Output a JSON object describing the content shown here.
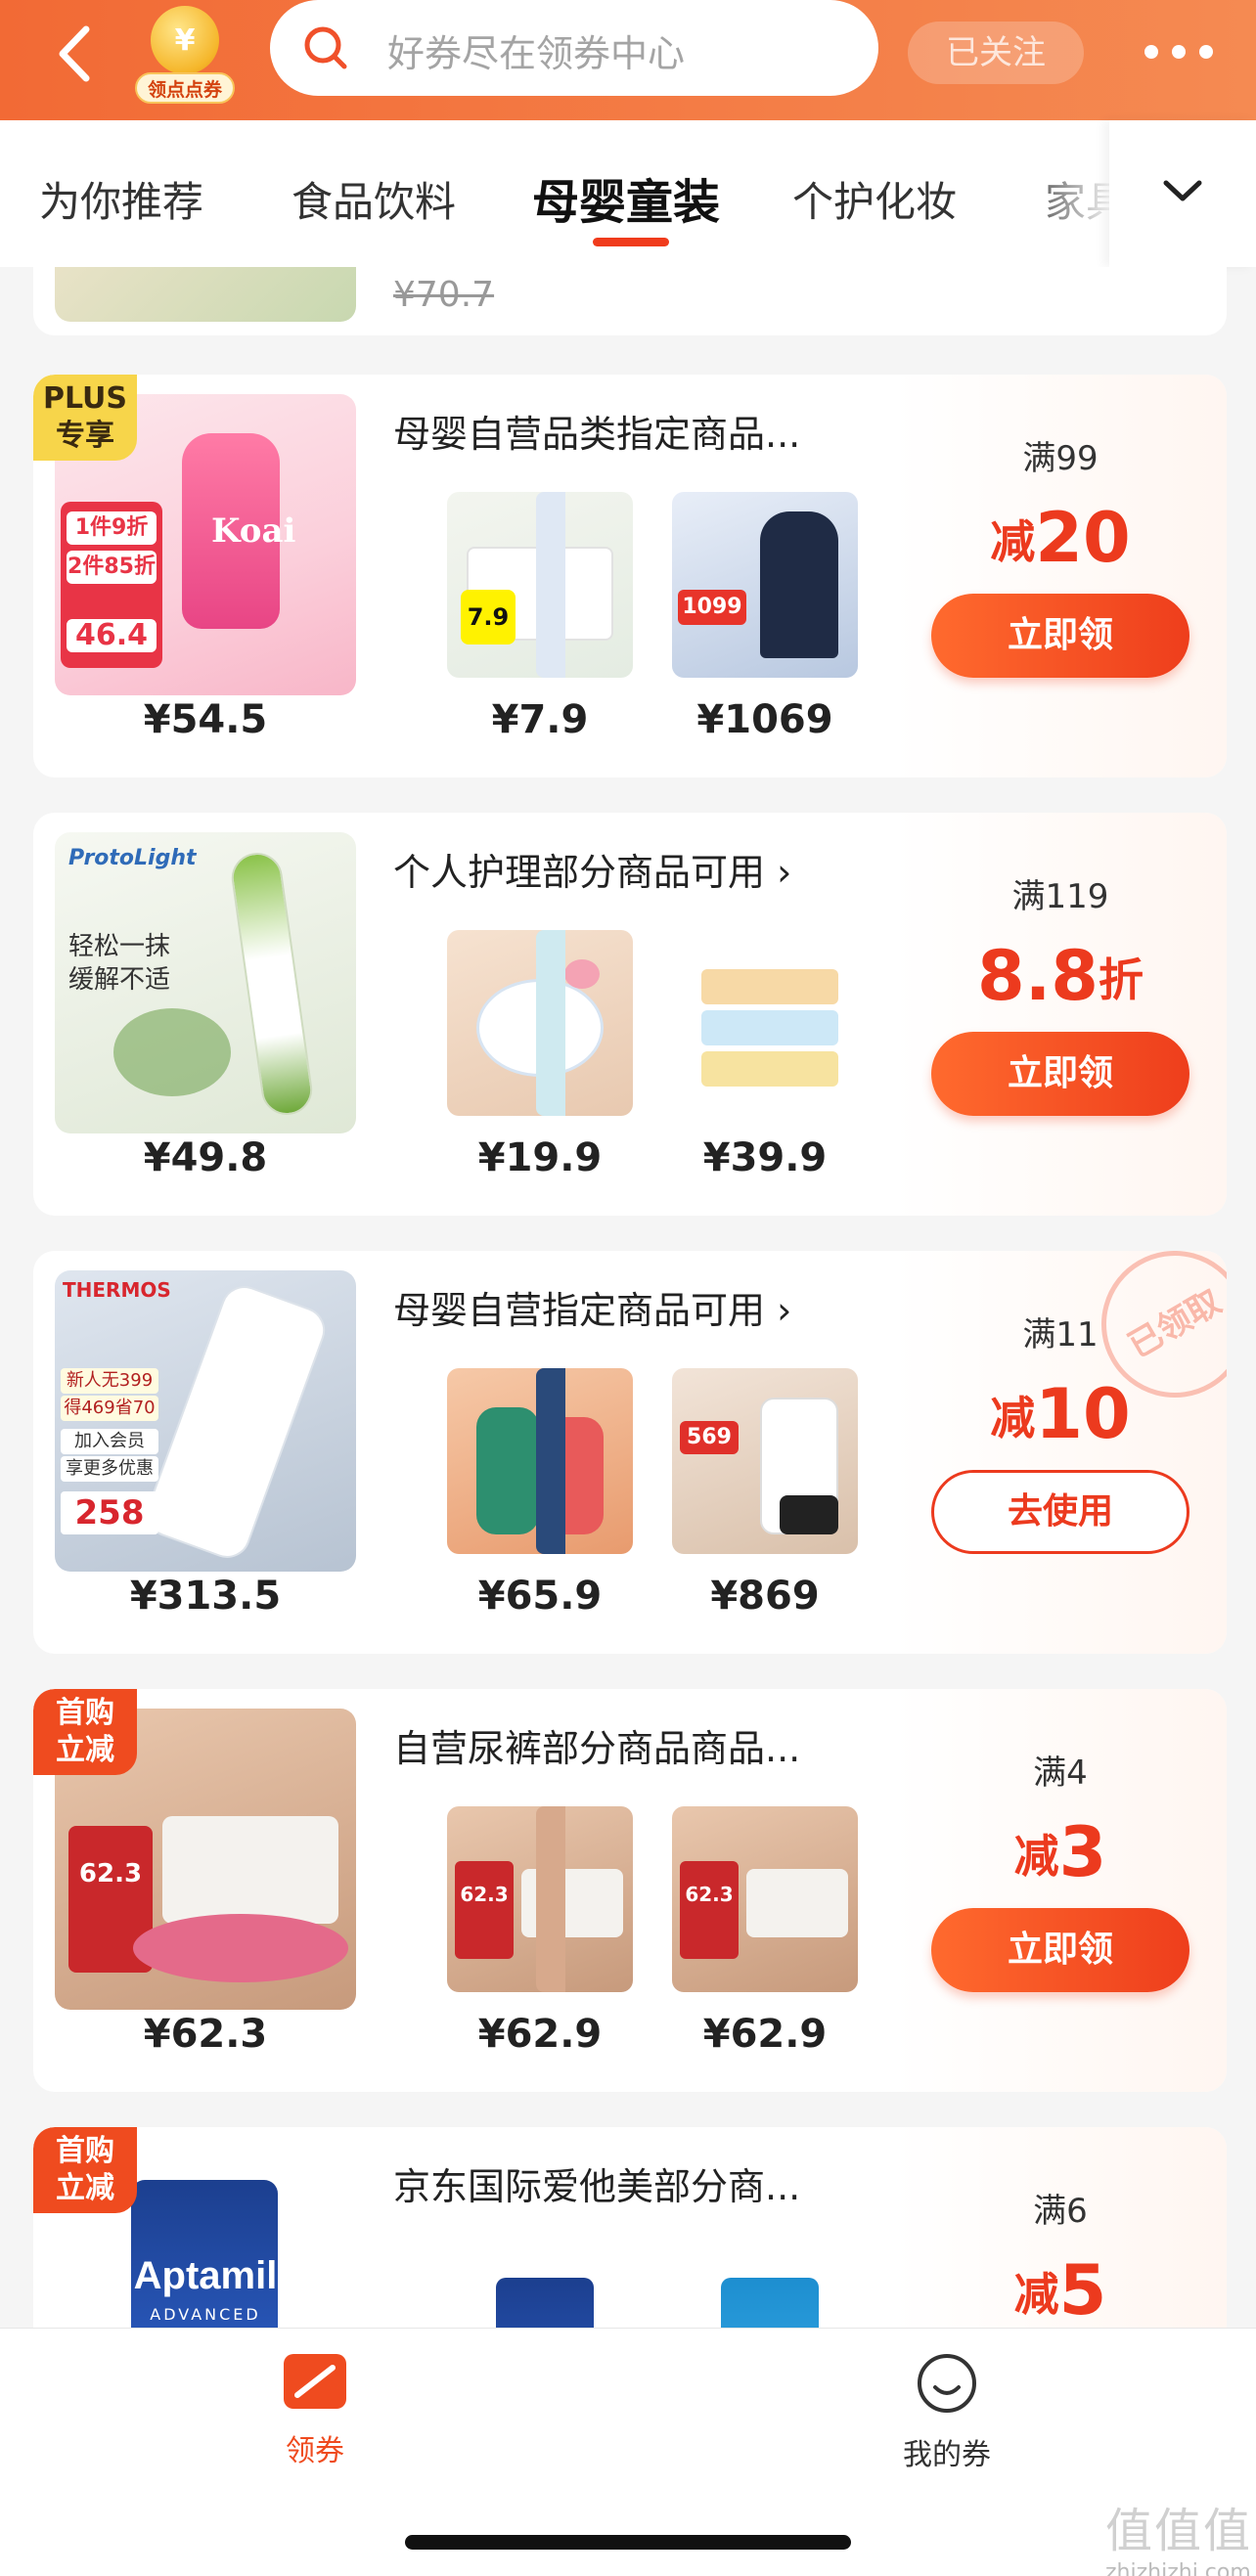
{
  "header": {
    "badge_symbol": "¥",
    "badge_label": "领点点券",
    "search_placeholder": "好券尽在领券中心",
    "follow_label": "已关注"
  },
  "tabs": [
    {
      "label": "为你推荐",
      "active": false
    },
    {
      "label": "食品饮料",
      "active": false
    },
    {
      "label": "母婴童装",
      "active": true
    },
    {
      "label": "个护化妆",
      "active": false
    },
    {
      "label": "家具",
      "active": false
    }
  ],
  "partial_card": {
    "price": "¥70.7"
  },
  "coupons": [
    {
      "corner_tag": "PLUS专享",
      "title": "母婴自营品类指定商品...",
      "main_price": "¥54.5",
      "main_img_text": [
        "1件9折",
        "2件85折",
        "46.4"
      ],
      "thumbs": [
        {
          "price": "¥7.9",
          "tag": "7.9"
        },
        {
          "price": "¥1069",
          "tag": "1099"
        }
      ],
      "threshold": "满99",
      "discount_prefix": "减",
      "discount_value": "20",
      "discount_suffix": "",
      "button": "立即领"
    },
    {
      "corner_tag": "",
      "title": "个人护理部分商品可用 ›",
      "main_price": "¥49.8",
      "main_img_text": [
        "ProtoLight",
        "轻松一抹",
        "缓解不适"
      ],
      "thumbs": [
        {
          "price": "¥19.9"
        },
        {
          "price": "¥39.9"
        }
      ],
      "threshold": "满119",
      "discount_prefix": "",
      "discount_value": "8.8",
      "discount_suffix": "折",
      "button": "立即领"
    },
    {
      "corner_tag": "",
      "stamp": "已领取",
      "title": "母婴自营指定商品可用 ›",
      "main_price": "¥313.5",
      "main_img_text": [
        "THERMOS",
        "新人无399",
        "得469省70",
        "加入会员",
        "享更多优惠",
        "258"
      ],
      "thumbs": [
        {
          "price": "¥65.9"
        },
        {
          "price": "¥869",
          "tag": "569"
        }
      ],
      "threshold": "满11",
      "discount_prefix": "减",
      "discount_value": "10",
      "discount_suffix": "",
      "button": "去使用"
    },
    {
      "corner_tag": "首购立减",
      "title": "自营尿裤部分商品商品...",
      "main_price": "¥62.3",
      "main_img_text": [
        "62.3"
      ],
      "thumbs": [
        {
          "price": "¥62.9",
          "tag": "62.3"
        },
        {
          "price": "¥62.9",
          "tag": "62.3"
        }
      ],
      "threshold": "满4",
      "discount_prefix": "减",
      "discount_value": "3",
      "discount_suffix": "",
      "button": "立即领"
    },
    {
      "corner_tag": "首购立减",
      "title": "京东国际爱他美部分商...",
      "main_price": "",
      "main_img_text": [
        "Aptamil",
        "ADVANCED"
      ],
      "thumbs": [
        {
          "price": ""
        },
        {
          "price": ""
        }
      ],
      "threshold": "满6",
      "discount_prefix": "减",
      "discount_value": "5",
      "discount_suffix": "",
      "button": ""
    }
  ],
  "bottom_nav": [
    {
      "label": "领券",
      "icon": "coupon-icon",
      "active": true
    },
    {
      "label": "我的券",
      "icon": "smile-icon",
      "active": false
    }
  ],
  "watermark": {
    "big": "值值值",
    "small": "zhizhizhi.com"
  },
  "colors": {
    "brand": "#f26a35",
    "accent": "#ec3a1e"
  }
}
